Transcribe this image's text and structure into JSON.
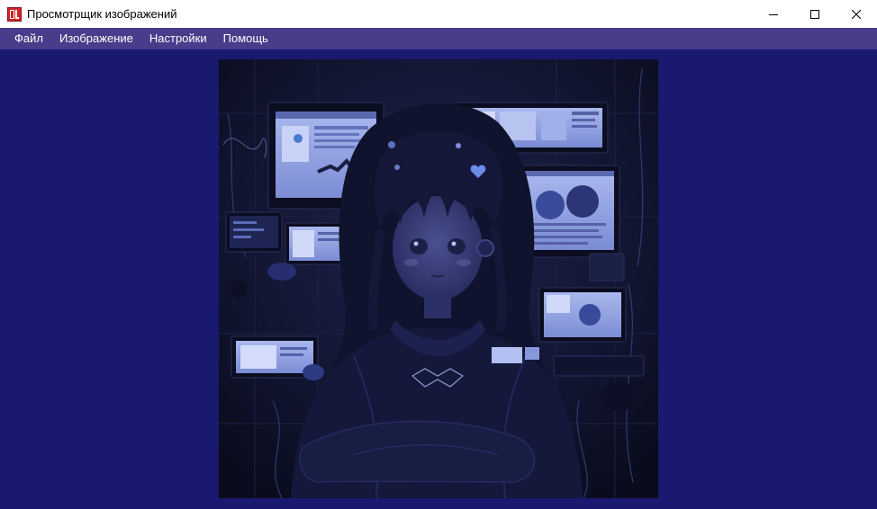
{
  "window": {
    "title": "Просмотрщик изображений",
    "icon": "app-logo-icon"
  },
  "controls": {
    "minimize_icon": "minimize-icon",
    "maximize_icon": "maximize-icon",
    "close_icon": "close-icon"
  },
  "menu": {
    "items": [
      {
        "label": "Файл"
      },
      {
        "label": "Изображение"
      },
      {
        "label": "Настройки"
      },
      {
        "label": "Помощь"
      }
    ]
  },
  "colors": {
    "titlebar": "#ffffff",
    "menubar": "#483d8b",
    "background": "#191970"
  }
}
